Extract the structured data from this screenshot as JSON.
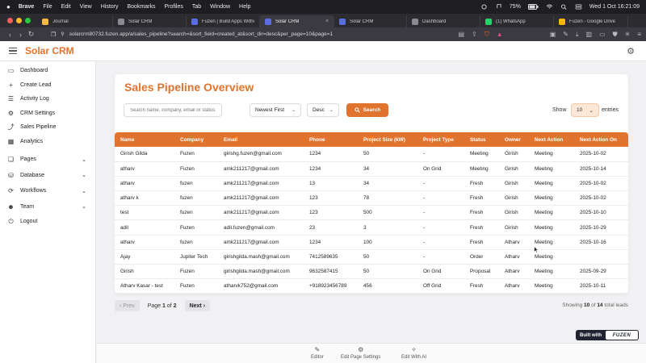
{
  "menubar": {
    "items": [
      "Brave",
      "File",
      "Edit",
      "View",
      "History",
      "Bookmarks",
      "Profiles",
      "Tab",
      "Window",
      "Help"
    ],
    "battery": "75%",
    "datetime": "Wed 1 Oct  16:21:09"
  },
  "tabs": [
    {
      "title": "Journal",
      "icon": "journal-icon",
      "color": "#f5b942"
    },
    {
      "title": "Solar CRM",
      "icon": "page-icon",
      "color": "#8a8a95"
    },
    {
      "title": "Fuzen | Build Apps Witho...",
      "icon": "fuzen-icon",
      "color": "#5b6ee1"
    },
    {
      "title": "Solar CRM",
      "icon": "fuzen-icon",
      "color": "#5b6ee1",
      "active": true
    },
    {
      "title": "Solar CRM",
      "icon": "fuzen-icon",
      "color": "#5b6ee1"
    },
    {
      "title": "Dashboard",
      "icon": "page-icon",
      "color": "#8a8a95"
    },
    {
      "title": "(1) WhatsApp",
      "icon": "whatsapp-icon",
      "color": "#25d366"
    },
    {
      "title": "Fuzen - Google Drive",
      "icon": "drive-icon",
      "color": "#f4b400"
    }
  ],
  "address": {
    "url": "solarcrm80732.fuzen.app/a/sales_pipeline?search=&sort_field=created_at&sort_dir=desc&per_page=10&page=1"
  },
  "header": {
    "brand": "Solar CRM"
  },
  "sidebar": {
    "items": [
      {
        "label": "Dashboard",
        "icon": "dashboard-icon",
        "glyph": "▭"
      },
      {
        "label": "Create Lead",
        "icon": "plus-icon",
        "glyph": "+"
      },
      {
        "label": "Activity Log",
        "icon": "log-icon",
        "glyph": "☰"
      },
      {
        "label": "CRM Settings",
        "icon": "settings-icon",
        "glyph": "⚙"
      },
      {
        "label": "Sales Pipeline",
        "icon": "chart-icon",
        "glyph": "⤴"
      },
      {
        "label": "Analytics",
        "icon": "analytics-icon",
        "glyph": "▦"
      }
    ],
    "groups": [
      {
        "label": "Pages",
        "icon": "pages-icon",
        "glyph": "❏"
      },
      {
        "label": "Database",
        "icon": "database-icon",
        "glyph": "⛁"
      },
      {
        "label": "Workflows",
        "icon": "workflow-icon",
        "glyph": "⟳"
      },
      {
        "label": "Team",
        "icon": "team-icon",
        "glyph": "☻"
      }
    ],
    "logout": {
      "label": "Logout",
      "icon": "logout-icon",
      "glyph": "⏻"
    }
  },
  "main": {
    "title": "Sales Pipeline Overview",
    "search_placeholder": "Search name, company, email or status...",
    "sort_field": "Newest First",
    "sort_dir": "Desc",
    "search_button": "Search",
    "show_label": "Show",
    "per_page": "10",
    "entries_label": "entries"
  },
  "table": {
    "columns": [
      "Name",
      "Company",
      "Email",
      "Phone",
      "Project Size (kW)",
      "Project Type",
      "Status",
      "Owner",
      "Next Action",
      "Next Action On"
    ],
    "rows": [
      [
        "Girish Gilda",
        "Fuzen",
        "girishg.fuzen@gmail.com",
        "1234",
        "50",
        "-",
        "Meeting",
        "Girish",
        "Meeting",
        "2025-10-02"
      ],
      [
        "atharv",
        "Fuzen",
        "amk211217@gmail.com",
        "1234",
        "34",
        "On Grid",
        "Meeting",
        "Girish",
        "Meeting",
        "2025-10-14"
      ],
      [
        "atharv",
        "fuzen",
        "amk211217@gmail.com",
        "13",
        "34",
        "-",
        "Fresh",
        "Girish",
        "Meeting",
        "2025-10-02"
      ],
      [
        "atharv k",
        "fuzen",
        "amk211217@gmail.com",
        "123",
        "78",
        "-",
        "Fresh",
        "Girish",
        "Meeting",
        "2025-10-02"
      ],
      [
        "test",
        "fuzen",
        "amk211217@gmail.com",
        "123",
        "500",
        "-",
        "Fresh",
        "Girish",
        "Meeting",
        "2025-10-10"
      ],
      [
        "adil",
        "Fuzen",
        "adil.fuzen@gmail.com",
        "23",
        "3",
        "-",
        "Fresh",
        "Girish",
        "Meeting",
        "2025-10-29"
      ],
      [
        "atharv",
        "fuzen",
        "amk211217@gmail.com",
        "1234",
        "100",
        "-",
        "Fresh",
        "Atharv",
        "Meeting",
        "2025-10-16"
      ],
      [
        "Ajay",
        "Jupiter Tech",
        "girishgilda.mash@gmail.com",
        "7412589635",
        "50",
        "-",
        "Order",
        "Atharv",
        "Meeting",
        ""
      ],
      [
        "Girish",
        "Fuzen",
        "girishgilda.mash@gmail.com",
        "9632587415",
        "50",
        "On Grid",
        "Proposal",
        "Atharv",
        "Meeting",
        "2025-09-29"
      ],
      [
        "Atharv Kasar - test",
        "Fuzen",
        "atharvk752@gmail.com",
        "+918923456789",
        "456",
        "Off Grid",
        "Fresh",
        "Atharv",
        "Meeting",
        "2025-10-11"
      ]
    ]
  },
  "pagination": {
    "prev": "Prev",
    "page_prefix": "Page",
    "page": "1",
    "of": "of",
    "total_pages": "2",
    "next": "Next",
    "showing_prefix": "Showing",
    "showing_count": "10",
    "showing_of": "of",
    "total": "14",
    "showing_suffix": "total leads"
  },
  "bottom": {
    "editor": "Editor",
    "page_settings": "Edit Page Settings",
    "edit_ai": "Edit With AI",
    "built_with": "Built with",
    "built_brand": "FUZEN"
  },
  "colors": {
    "accent": "#e0742f"
  }
}
